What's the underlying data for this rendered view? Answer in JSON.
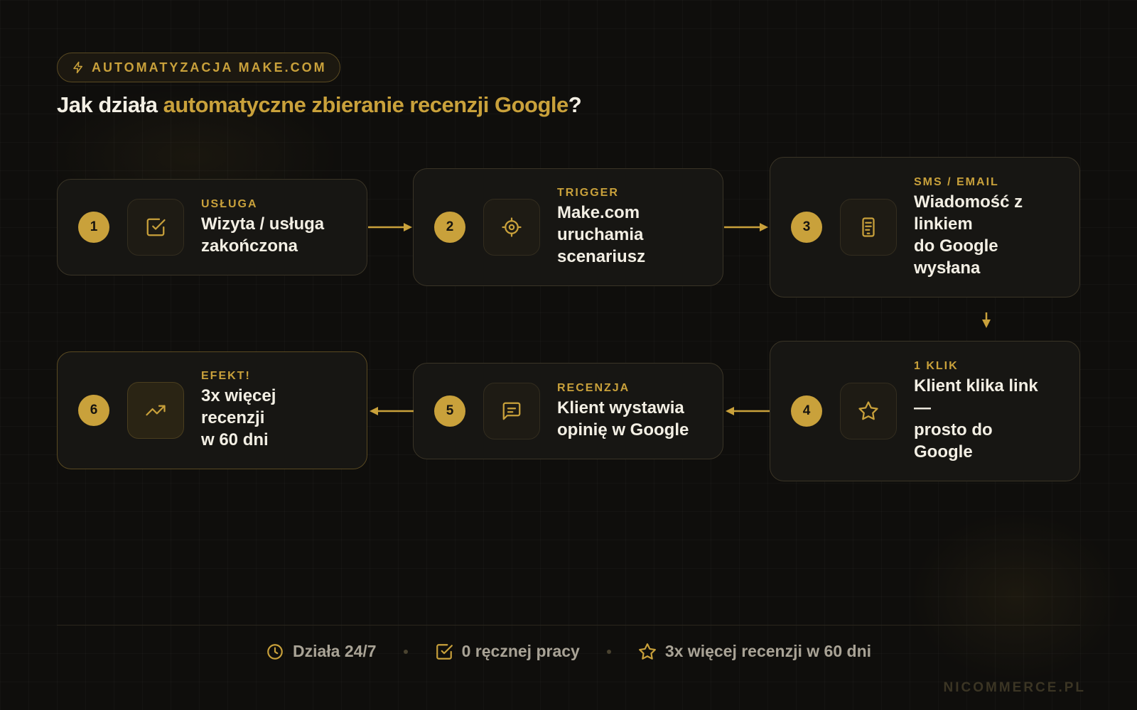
{
  "badge": {
    "icon": "lightning-icon",
    "text": "AUTOMATYZACJA MAKE.COM"
  },
  "title": {
    "prefix": "Jak działa ",
    "highlight": "automatyczne zbieranie recenzji Google",
    "suffix": "?"
  },
  "steps": [
    {
      "number": "1",
      "label": "USŁUGA",
      "text": "Wizyta / usługa\nzakończona",
      "icon": "check-square-icon"
    },
    {
      "number": "2",
      "label": "TRIGGER",
      "text": "Make.com\nuruchamia\nscenariusz",
      "icon": "target-icon"
    },
    {
      "number": "3",
      "label": "SMS / EMAIL",
      "text": "Wiadomość z\nlinkiem\ndo Google\nwysłana",
      "icon": "phone-icon"
    },
    {
      "number": "4",
      "label": "1 KLIK",
      "text": "Klient klika link\n—\nprosto do\nGoogle",
      "icon": "star-icon"
    },
    {
      "number": "5",
      "label": "RECENZJA",
      "text": "Klient wystawia\nopinię w Google",
      "icon": "message-icon"
    },
    {
      "number": "6",
      "label": "EFEKT!",
      "text": "3x więcej\nrecenzji\nw 60 dni",
      "icon": "trending-up-icon"
    }
  ],
  "footer": {
    "items": [
      {
        "icon": "clock-icon",
        "text": "Działa 24/7"
      },
      {
        "icon": "check-square-icon",
        "text": "0 ręcznej pracy"
      },
      {
        "icon": "star-icon",
        "text": "3x więcej recenzji w 60 dni"
      }
    ]
  },
  "brand": "NICOMMERCE.PL",
  "colors": {
    "accent": "#c9a13b",
    "background": "#0f0e0c",
    "card": "#171613",
    "text": "#f3efe4",
    "muted": "#a9a396"
  }
}
